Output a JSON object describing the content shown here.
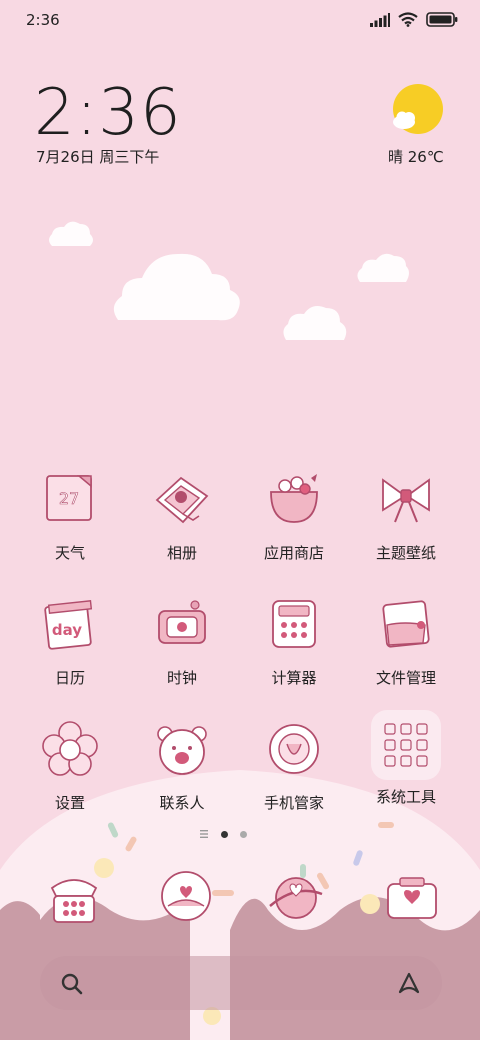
{
  "status": {
    "time": "2:36"
  },
  "widget": {
    "clock": "2:36",
    "date": "7月26日 周三下午",
    "weather": "晴 26℃"
  },
  "apps": [
    {
      "label": "天气",
      "icon": "calendar-27-icon",
      "badge": "27"
    },
    {
      "label": "相册",
      "icon": "photo-envelope-icon"
    },
    {
      "label": "应用商店",
      "icon": "shopping-bag-icon"
    },
    {
      "label": "主题壁纸",
      "icon": "bow-icon"
    },
    {
      "label": "日历",
      "icon": "day-calendar-icon",
      "badge": "day"
    },
    {
      "label": "时钟",
      "icon": "clock-box-icon"
    },
    {
      "label": "计算器",
      "icon": "calculator-icon"
    },
    {
      "label": "文件管理",
      "icon": "folder-icon"
    },
    {
      "label": "设置",
      "icon": "flower-icon"
    },
    {
      "label": "联系人",
      "icon": "bear-icon"
    },
    {
      "label": "手机管家",
      "icon": "shield-donut-icon"
    },
    {
      "label": "系统工具",
      "icon": "folder-grid-icon"
    }
  ],
  "dock": [
    {
      "name": "phone",
      "icon": "telephone-icon"
    },
    {
      "name": "messages",
      "icon": "chat-bubble-icon"
    },
    {
      "name": "browser",
      "icon": "planet-icon"
    },
    {
      "name": "camera",
      "icon": "camera-icon"
    }
  ],
  "search": {
    "left_icon": "search-icon",
    "right_icon": "assistant-icon"
  }
}
